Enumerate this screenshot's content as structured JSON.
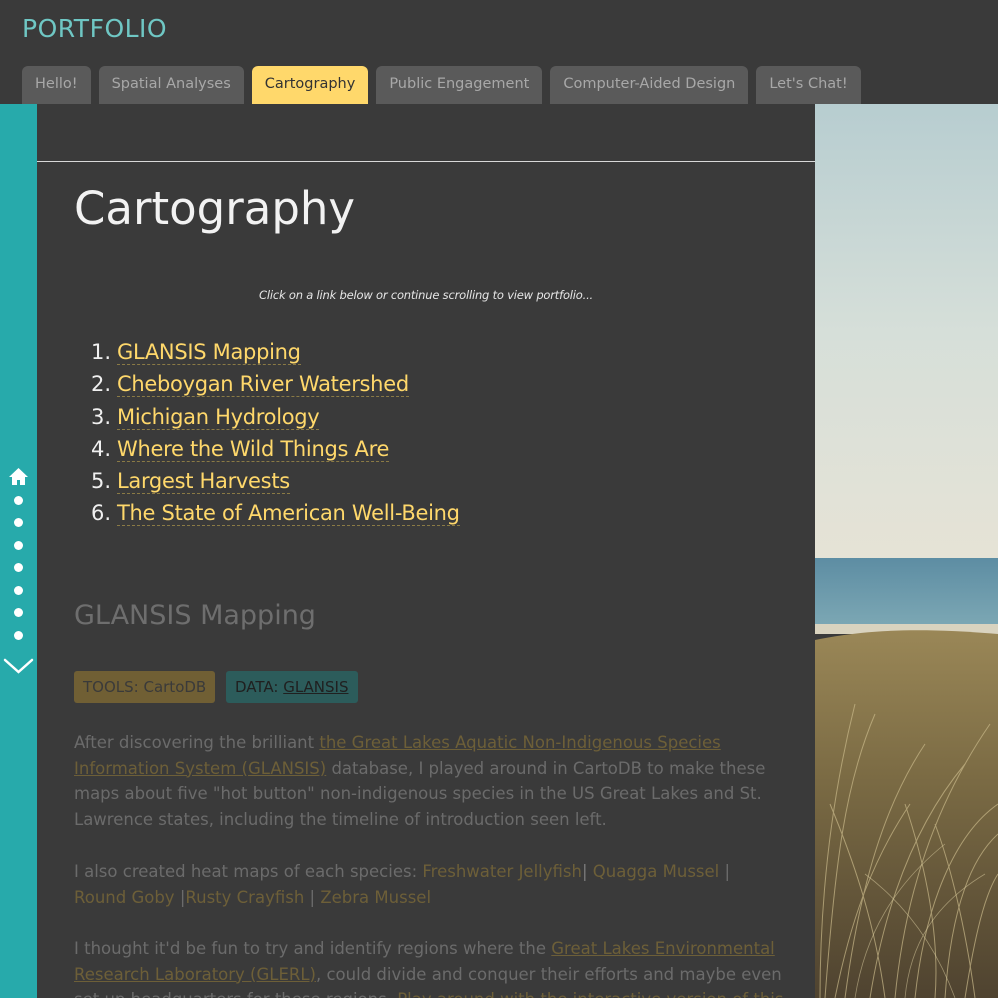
{
  "brand": "PORTFOLIO",
  "tabs": [
    "Hello!",
    "Spatial Analyses",
    "Cartography",
    "Public Engagement",
    "Computer-Aided Design",
    "Let's Chat!"
  ],
  "active_tab": "Cartography",
  "page_title": "Cartography",
  "hint": "Click on a link below or continue scrolling to view portfolio...",
  "toc": [
    {
      "num": "1.",
      "label": "GLANSIS Mapping"
    },
    {
      "num": "2.",
      "label": "Cheboygan River Watershed"
    },
    {
      "num": "3.",
      "label": "Michigan Hydrology"
    },
    {
      "num": "4.",
      "label": "Where the Wild Things Are"
    },
    {
      "num": "5.",
      "label": "Largest Harvests"
    },
    {
      "num": "6.",
      "label": "The State of American Well-Being"
    }
  ],
  "section": {
    "title": "GLANSIS Mapping",
    "tools_badge": "TOOLS: CartoDB",
    "data_badge_prefix": "DATA:",
    "data_badge_link": "GLANSIS",
    "p1_start": "After discovering the brilliant ",
    "p1_link": "the Great Lakes Aquatic Non-Indigenous Species Information System (GLANSIS)",
    "p1_end": " database, I played around in CartoDB to make these maps about five \"hot button\" non-indigenous species in the US Great Lakes and St. Lawrence states, including the timeline of introduction seen left.",
    "p2_start": "I also created heat maps of each species: ",
    "species": [
      "Freshwater Jellyfish",
      "Quagga Mussel",
      "Round Goby",
      "Rusty Crayfish",
      "Zebra Mussel"
    ],
    "p3_start": "I thought it'd be fun to try and identify regions where the ",
    "p3_link": "Great Lakes Environmental Research Laboratory (GLERL)",
    "p3_mid": ", could divide and conquer their efforts and maybe even set up headquarters for these regions. ",
    "p3_link2": "Play around with the interactive version of this heat"
  },
  "sidenav": {
    "home_icon": "home-icon",
    "dots": 7,
    "down_icon": "chevron-down-icon"
  },
  "colors": {
    "accent": "#ffd86b",
    "teal": "#27aaab",
    "brand": "#6fc7c4",
    "panel": "#3a3a3a"
  }
}
